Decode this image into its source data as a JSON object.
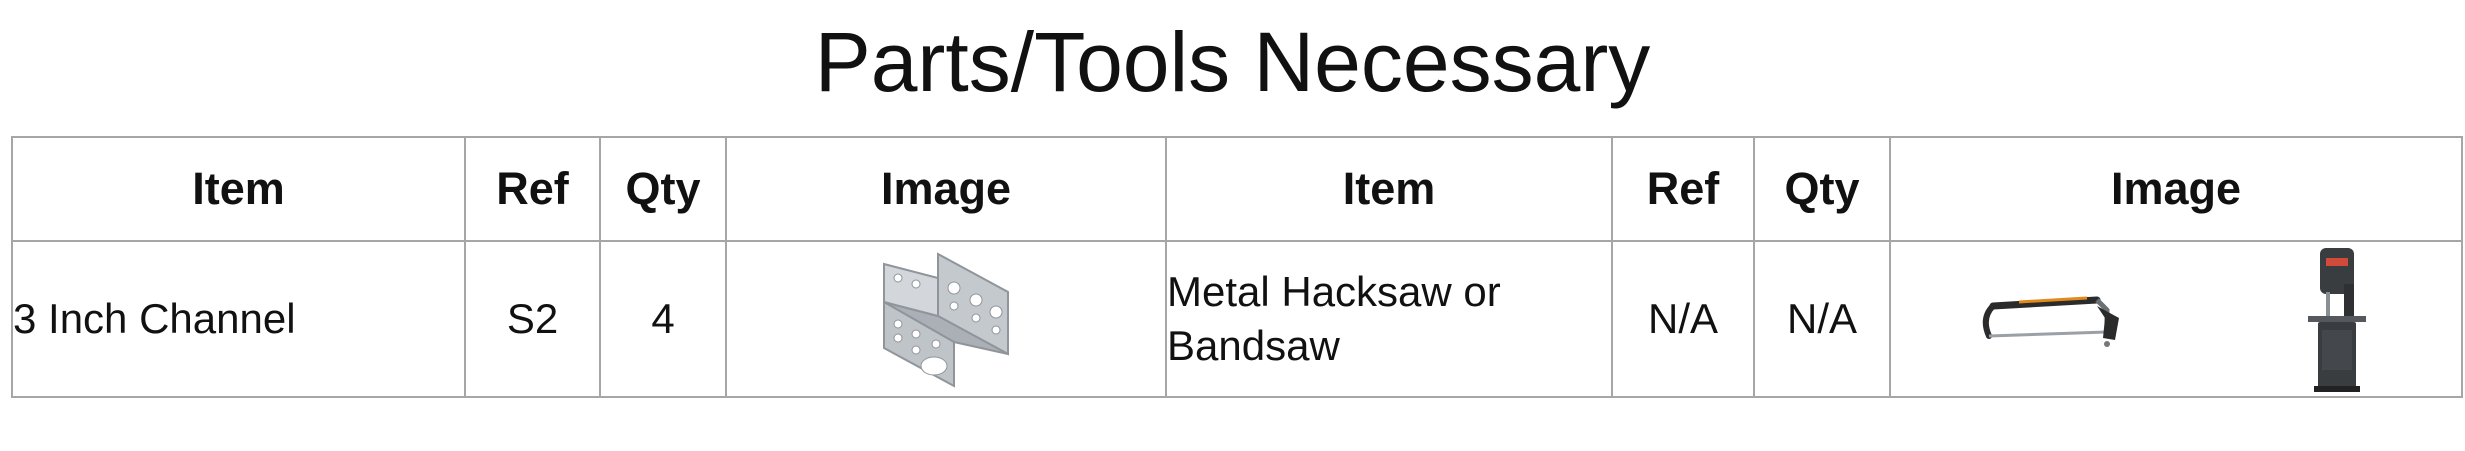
{
  "title": "Parts/Tools Necessary",
  "table": {
    "headers": [
      "Item",
      "Ref",
      "Qty",
      "Image",
      "Item",
      "Ref",
      "Qty",
      "Image"
    ],
    "rows": [
      {
        "part_item": "3 Inch Channel",
        "part_ref": "S2",
        "part_qty": "4",
        "part_image_icon": "aluminum-channel-icon",
        "tool_item": "Metal Hacksaw or Bandsaw",
        "tool_ref": "N/A",
        "tool_qty": "N/A",
        "tool_image_icons": [
          "hacksaw-icon",
          "bandsaw-icon"
        ]
      }
    ]
  },
  "colors": {
    "border": "#a6a6a6",
    "text": "#111111",
    "metal": "#b9bec3",
    "hacksaw_frame": "#2b2b2b",
    "hacksaw_accent": "#e08a1e",
    "bandsaw_body": "#3a3d40"
  }
}
